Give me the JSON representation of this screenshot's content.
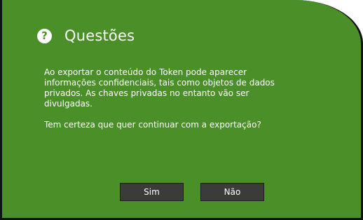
{
  "dialog": {
    "title": "Questões",
    "icon": "help-icon",
    "message_1_line_1": "Ao exportar o conteúdo do Token pode aparecer",
    "message_1_line_2": "informações confidenciais, tais como objetos de dados",
    "message_1_line_3": "privados. As chaves privadas no entanto vão ser",
    "message_1_line_4": "divulgadas.",
    "message_2": "Tem certeza que quer continuar com a exportação?",
    "buttons": {
      "yes": "Sim",
      "no": "Não"
    },
    "colors": {
      "background": "#4b8f29",
      "border": "#111111",
      "button": "#3b3b3b",
      "text": "#ffffff"
    }
  }
}
